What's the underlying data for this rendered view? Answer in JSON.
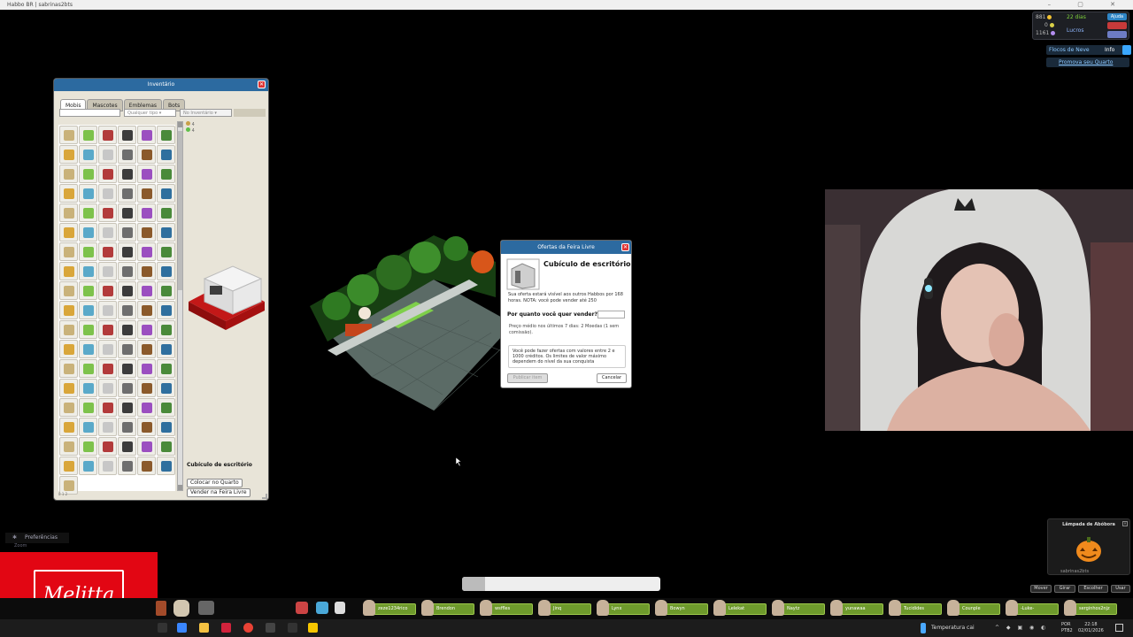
{
  "window": {
    "title": "Habbo BR | sabrinas2bts"
  },
  "hud": {
    "credits": "881",
    "duckets": "0",
    "diamonds": "1161",
    "club_days": "22 dias",
    "lucros": "Lucros",
    "help": "Ajuda",
    "event_label": "Flocos de Neve",
    "event_info": "Info",
    "promote": "Promova seu Quarto"
  },
  "inventory": {
    "title": "Inventário",
    "tabs": [
      "Mobis",
      "Mascotes",
      "Emblemas",
      "Bots"
    ],
    "filter_type": "Qualquer tipo",
    "filter_location": "No Inventário",
    "selected_item": "Cubículo de escritório",
    "place_button": "Colocar no Quarto",
    "sell_button": "Vender na Feira Livre",
    "counter_a": "4",
    "counter_b": "4",
    "page": "8 1 2"
  },
  "marketplace": {
    "title": "Ofertas da Feira Livre",
    "item_name": "Cubículo de escritório",
    "info": "Sua oferta estará visível aos outros Habbos por 168 horas. NOTA: você pode vender até 250",
    "price_question": "Por quanto você quer vender?",
    "average": "Preço médio nos últimos 7 dias: 2 Moedas (1 sem comissão).",
    "limits": "Você pode fazer ofertas com valores entre 2 e 1000 créditos. Os limites de valor máximo dependem do nível da sua conquista",
    "publish": "Publicar item",
    "cancel": "Cancelar"
  },
  "left_menu": {
    "preferences": "Preferências",
    "zoom": "Zoom"
  },
  "brand": {
    "logo": "Melitta"
  },
  "lamp": {
    "title": "Lâmpada de Abóbora",
    "owner": "sabrinas2bts",
    "buttons": [
      "Mover",
      "Girar",
      "Escolher",
      "Usar"
    ]
  },
  "friends": [
    "zeze1234rico",
    "Brendon",
    "wsffles",
    "Jinq",
    "Lynx",
    "Bowyn",
    "Lelekat",
    "Naytz",
    "yunawaa",
    "Tucidides",
    "Counple",
    "-Luke-",
    "serginhos2njz"
  ],
  "taskbar": {
    "weather": "Temperatura cai",
    "lang": "POR",
    "lang2": "PTB2",
    "time": "22:18",
    "date": "02/01/2026"
  },
  "colors": {
    "accent": "#2c6aa0",
    "habbo_green": "#6e9a2c",
    "brand_red": "#e20613"
  }
}
